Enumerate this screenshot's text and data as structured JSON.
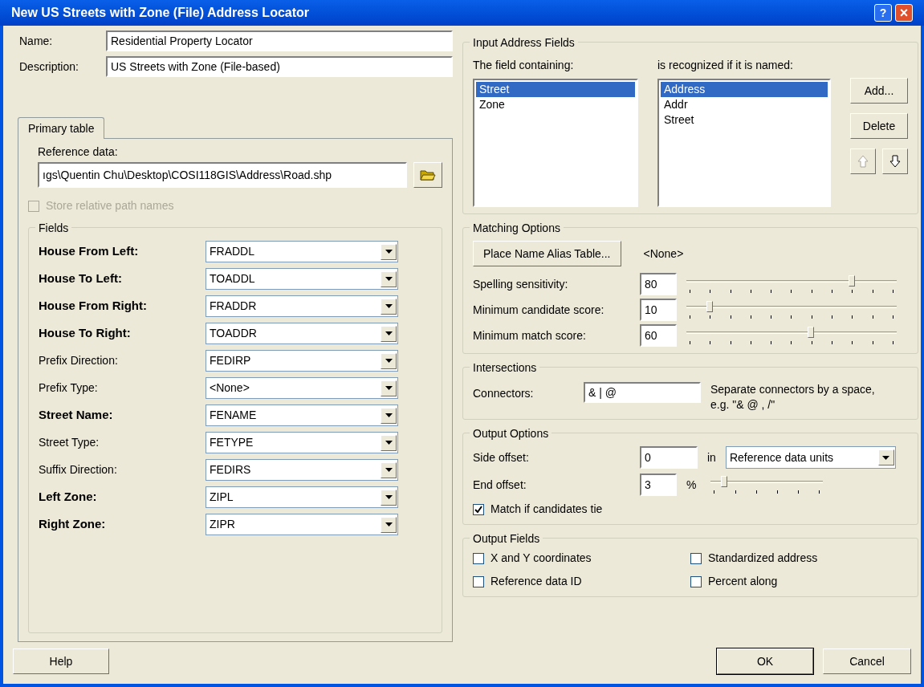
{
  "window": {
    "title": "New US Streets with Zone (File) Address Locator",
    "help_button": "?",
    "close_button": "×"
  },
  "name": {
    "label": "Name:",
    "value": "Residential Property Locator"
  },
  "description": {
    "label": "Description:",
    "value": "US Streets with Zone (File-based)"
  },
  "tabs": [
    {
      "label": "Primary table",
      "selected": true
    }
  ],
  "reference_data": {
    "label": "Reference data:",
    "value": "ıgs\\Quentin Chu\\Desktop\\COSI118GIS\\Address\\Road.shp"
  },
  "store_relative": {
    "label": "Store relative path names",
    "checked": false,
    "disabled": true
  },
  "fields": {
    "title": "Fields",
    "rows": [
      {
        "label": "House From Left:",
        "required": true,
        "value": "FRADDL"
      },
      {
        "label": "House To Left:",
        "required": true,
        "value": "TOADDL"
      },
      {
        "label": "House From Right:",
        "required": true,
        "value": "FRADDR"
      },
      {
        "label": "House To Right:",
        "required": true,
        "value": "TOADDR"
      },
      {
        "label": "Prefix Direction:",
        "required": false,
        "value": "FEDIRP"
      },
      {
        "label": "Prefix Type:",
        "required": false,
        "value": "<None>"
      },
      {
        "label": "Street Name:",
        "required": true,
        "value": "FENAME"
      },
      {
        "label": "Street Type:",
        "required": false,
        "value": "FETYPE"
      },
      {
        "label": "Suffix Direction:",
        "required": false,
        "value": "FEDIRS"
      },
      {
        "label": "Left Zone:",
        "required": true,
        "value": "ZIPL"
      },
      {
        "label": "Right Zone:",
        "required": true,
        "value": "ZIPR"
      }
    ]
  },
  "input_address_fields": {
    "title": "Input Address Fields",
    "left_label": "The field containing:",
    "right_label": "is recognized if it is named:",
    "left_items": [
      {
        "label": "Street",
        "selected": true
      },
      {
        "label": "Zone",
        "selected": false
      }
    ],
    "right_items": [
      {
        "label": "Address",
        "selected": true
      },
      {
        "label": "Addr",
        "selected": false
      },
      {
        "label": "Street",
        "selected": false
      }
    ],
    "add_button": "Add...",
    "delete_button": "Delete",
    "up_disabled": true,
    "down_disabled": false
  },
  "matching_options": {
    "title": "Matching Options",
    "alias_button": "Place Name Alias Table...",
    "alias_value": "<None>",
    "sliders": [
      {
        "label": "Spelling sensitivity:",
        "value": "80",
        "level": 0.8
      },
      {
        "label": "Minimum candidate score:",
        "value": "10",
        "level": 0.1
      },
      {
        "label": "Minimum match score:",
        "value": "60",
        "level": 0.6
      }
    ]
  },
  "intersections": {
    "title": "Intersections",
    "label": "Connectors:",
    "value": "& | @",
    "hint": "Separate connectors by a space, e.g. \"& @ , /\""
  },
  "output_options": {
    "title": "Output Options",
    "side_offset_label": "Side offset:",
    "side_offset_value": "0",
    "in_label": "in",
    "units": "Reference data units",
    "end_offset_label": "End offset:",
    "end_offset_value": "3",
    "percent": "%",
    "end_offset_slider": {
      "level": 0.1
    },
    "tie": {
      "label": "Match if candidates tie",
      "checked": true
    }
  },
  "output_fields": {
    "title": "Output Fields",
    "items": [
      {
        "label": "X and Y coordinates",
        "checked": false
      },
      {
        "label": "Standardized address",
        "checked": false
      },
      {
        "label": "Reference data ID",
        "checked": false
      },
      {
        "label": "Percent along",
        "checked": false
      }
    ]
  },
  "buttons": {
    "help": "Help",
    "ok": "OK",
    "cancel": "Cancel"
  }
}
